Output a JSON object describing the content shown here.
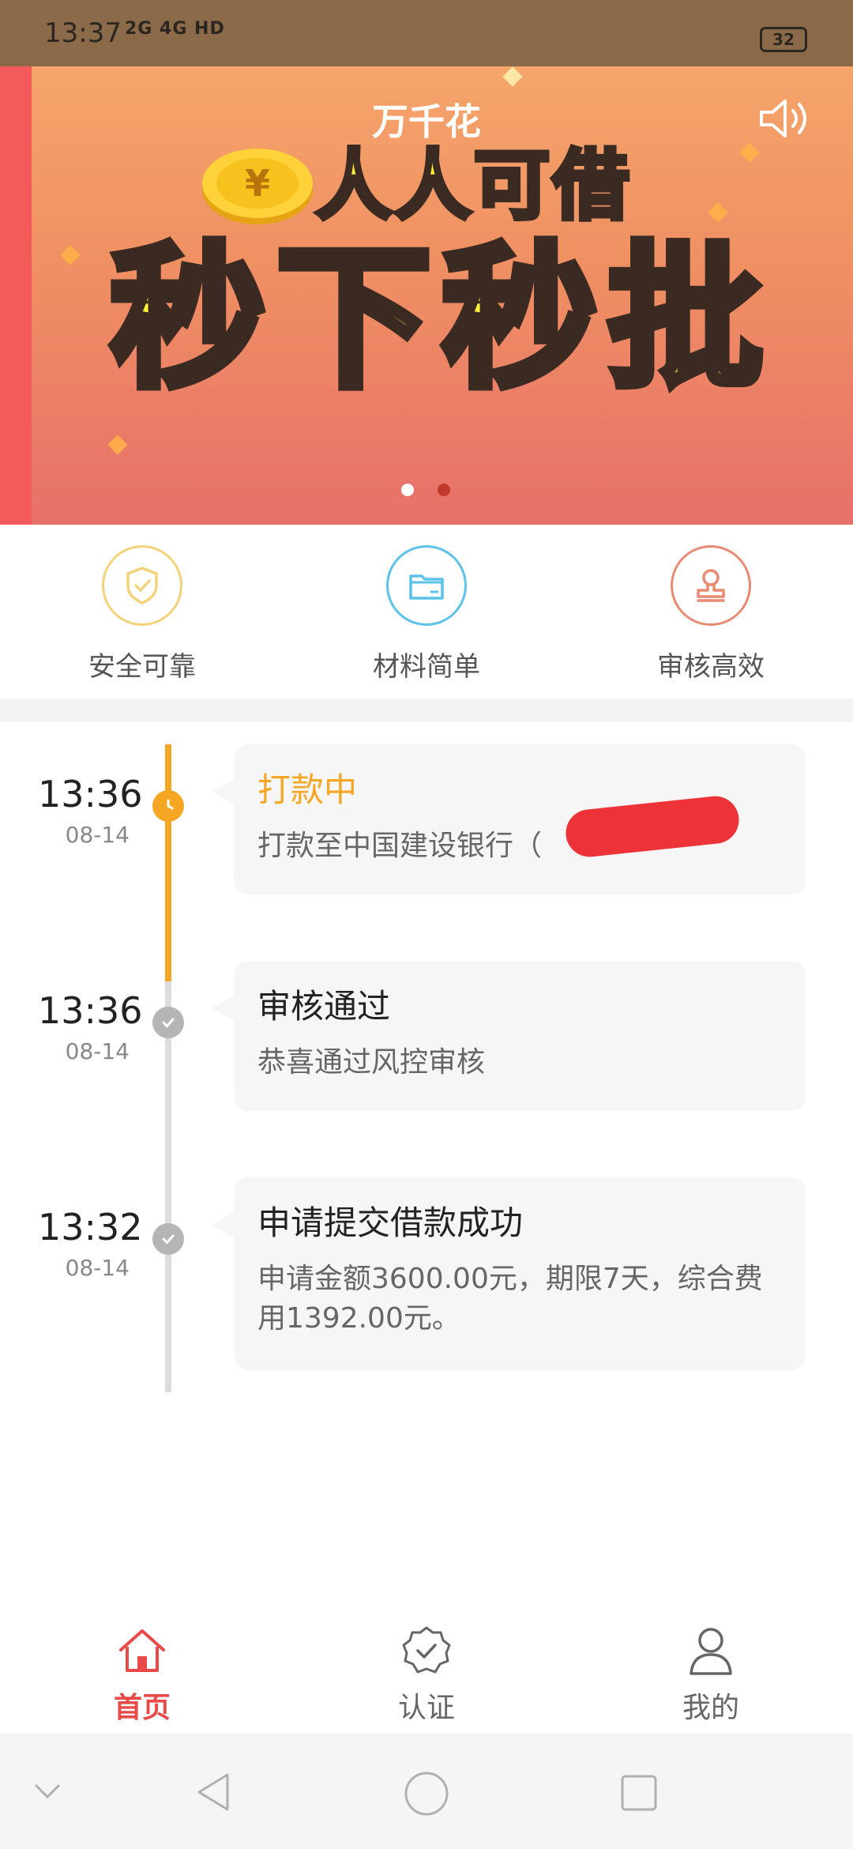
{
  "status_bar": {
    "time": "13:37",
    "signal_text": "2G 4G HD",
    "battery": "32"
  },
  "banner": {
    "app_name": "万千花",
    "headline": "人人可借",
    "main_text": "秒下秒批",
    "colors": {
      "headline": "#ffef3a",
      "outline": "#3a2a22"
    },
    "icons": [
      "speaker-icon",
      "coin-icon"
    ],
    "carousel": {
      "total": 2,
      "active": 1
    }
  },
  "features": [
    {
      "label": "安全可靠",
      "icon": "shield-icon",
      "color": "#f3d27a"
    },
    {
      "label": "材料简单",
      "icon": "folder-icon",
      "color": "#5bc3e8"
    },
    {
      "label": "审核高效",
      "icon": "stamp-icon",
      "color": "#e98a73"
    }
  ],
  "timeline": [
    {
      "time": "13:36",
      "date": "08-14",
      "title": "打款中",
      "desc": "打款至中国建设银行（",
      "status": "active",
      "color": "#f5a623"
    },
    {
      "time": "13:36",
      "date": "08-14",
      "title": "审核通过",
      "desc": "恭喜通过风控审核",
      "status": "done",
      "color": "#222222"
    },
    {
      "time": "13:32",
      "date": "08-14",
      "title": "申请提交借款成功",
      "desc": "申请金额3600.00元，期限7天，综合费用1392.00元。",
      "status": "done",
      "color": "#222222"
    }
  ],
  "tabbar": [
    {
      "label": "首页",
      "icon": "home-icon",
      "active": true
    },
    {
      "label": "认证",
      "icon": "verify-badge-icon",
      "active": false
    },
    {
      "label": "我的",
      "icon": "user-icon",
      "active": false
    }
  ],
  "colors": {
    "accent": "#e84a4a",
    "tab_inactive": "#666666"
  }
}
